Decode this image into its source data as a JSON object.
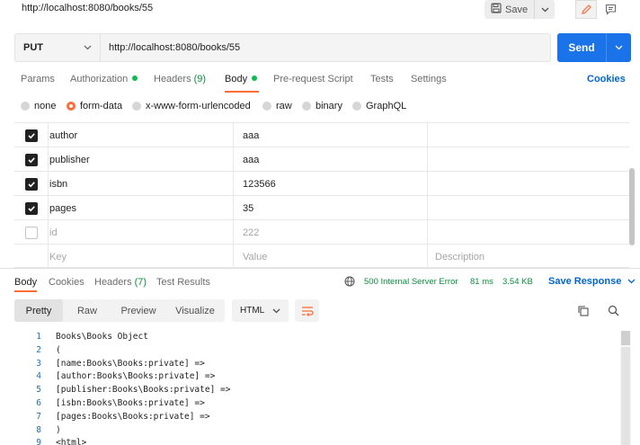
{
  "top": {
    "url": "http://localhost:8080/books/55",
    "save_label": "Save"
  },
  "request": {
    "method": "PUT",
    "url": "http://localhost:8080/books/55",
    "send_label": "Send"
  },
  "req_tabs": {
    "params": "Params",
    "authorization": "Authorization",
    "headers": "Headers",
    "headers_count": "(9)",
    "body": "Body",
    "prerequest": "Pre-request Script",
    "tests": "Tests",
    "settings": "Settings",
    "cookies": "Cookies"
  },
  "body_types": {
    "none": "none",
    "form_data": "form-data",
    "urlencoded": "x-www-form-urlencoded",
    "raw": "raw",
    "binary": "binary",
    "graphql": "GraphQL",
    "selected": "form-data"
  },
  "form": {
    "rows": [
      {
        "key": "author",
        "value": "aaa",
        "checked": true
      },
      {
        "key": "publisher",
        "value": "aaa",
        "checked": true
      },
      {
        "key": "isbn",
        "value": "123566",
        "checked": true
      },
      {
        "key": "pages",
        "value": "35",
        "checked": true
      },
      {
        "key": "id",
        "value": "222",
        "checked": false
      }
    ],
    "placeholder": {
      "key": "Key",
      "value": "Value",
      "description": "Description"
    }
  },
  "resp_tabs": {
    "body": "Body",
    "cookies": "Cookies",
    "headers": "Headers",
    "headers_count": "(7)",
    "test_results": "Test Results",
    "status": "500 Internal Server Error",
    "time": "81 ms",
    "size": "3.54 KB",
    "save_response": "Save Response"
  },
  "resp_toolbar": {
    "pretty": "Pretty",
    "raw": "Raw",
    "preview": "Preview",
    "visualize": "Visualize",
    "format": "HTML"
  },
  "code": {
    "lines": [
      {
        "n": "1",
        "t": "Books\\Books Object"
      },
      {
        "n": "2",
        "t": "("
      },
      {
        "n": "3",
        "t": "[name:Books\\Books:private] =>"
      },
      {
        "n": "4",
        "t": "[author:Books\\Books:private] =>"
      },
      {
        "n": "5",
        "t": "[publisher:Books\\Books:private] =>"
      },
      {
        "n": "6",
        "t": "[isbn:Books\\Books:private] =>"
      },
      {
        "n": "7",
        "t": "[pages:Books\\Books:private] =>"
      },
      {
        "n": "8",
        "t": ")"
      },
      {
        "n": "9",
        "t": "<html>"
      }
    ]
  },
  "colors": {
    "accent": "#ff6c37",
    "send": "#1a73e8",
    "link": "#0265d2",
    "status_ok_dot": "#0cbb52",
    "status_text": "#0a8f3c"
  }
}
